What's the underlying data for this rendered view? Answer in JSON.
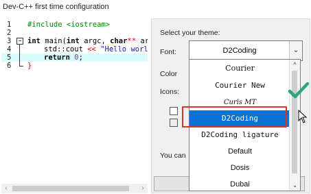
{
  "window": {
    "title": "Dev-C++ first time configuration"
  },
  "editor": {
    "lines": [
      {
        "number": "1",
        "text": "#include <iostream>"
      },
      {
        "number": "2",
        "text": ""
      },
      {
        "number": "3",
        "keyword": "int",
        "text": " main(",
        "kw2": "int",
        "text2": " argc, ",
        "kw3": "char",
        "op": "**",
        "text3": " argv)"
      },
      {
        "number": "4",
        "text": "std::cout ",
        "op": "<<",
        "string": " \"Hello world!\\"
      },
      {
        "number": "5",
        "keyword": "return",
        "number_literal": " 0",
        "text": ";"
      },
      {
        "number": "6",
        "brace": "}"
      }
    ]
  },
  "panel": {
    "theme_label": "Select your theme:",
    "font_label": "Font:",
    "font_value": "D2Coding",
    "color_label": "Color",
    "icons_label": "Icons:",
    "info_label": "You can",
    "dropdown_options": [
      "Courier",
      "Courier New",
      "Curls MT",
      "D2Coding",
      "D2Coding ligature",
      "Default",
      "Dosis",
      "Dubai"
    ],
    "selected_option": "D2Coding"
  },
  "icons": {
    "dropdown_arrow": "chevron-down-icon",
    "scroll_up": "chevron-up-icon",
    "scroll_down": "chevron-down-icon",
    "scroll_left": "chevron-left-icon",
    "scroll_right": "chevron-right-icon",
    "checkmark": "checkmark-icon",
    "cursor": "mouse-pointer-icon"
  },
  "colors": {
    "selection": "#0a72d4",
    "highlight_frame": "#e0302c",
    "checkmark": "#2aa876",
    "preprocessor": "#008a00",
    "string": "#1515c4"
  }
}
